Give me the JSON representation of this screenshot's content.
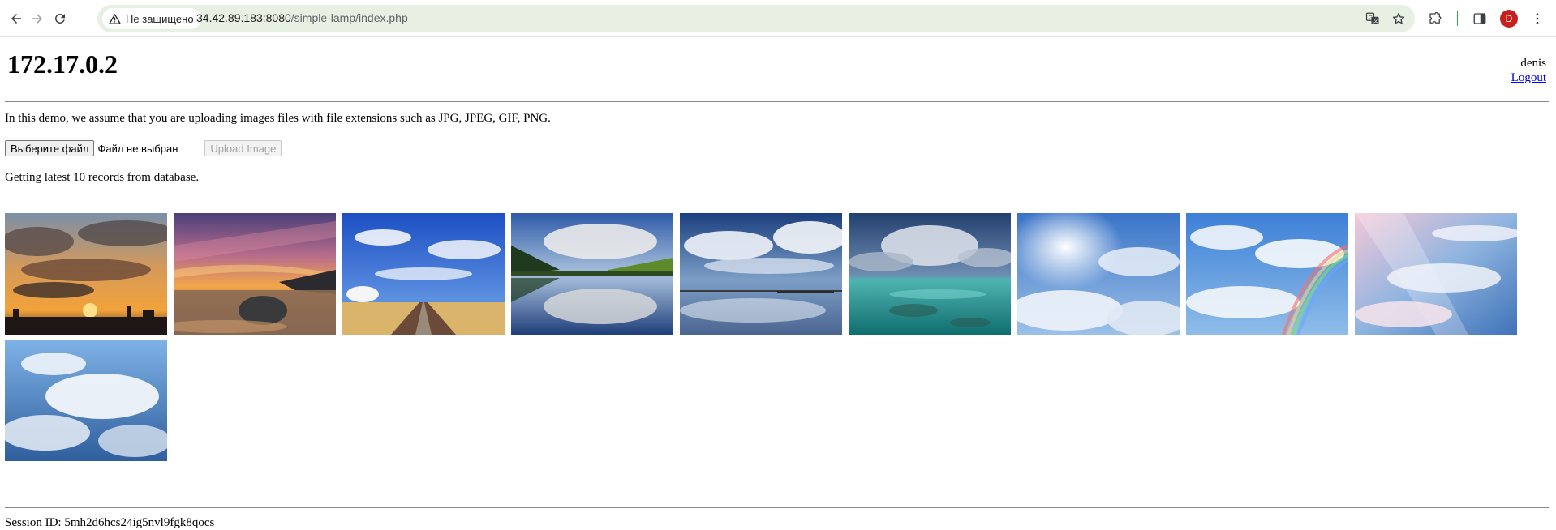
{
  "browser": {
    "security_label": "Не защищено",
    "url_host": "34.42.89.183:8080",
    "url_path": "/simple-lamp/index.php",
    "profile_initial": "D",
    "icons": [
      "back-icon",
      "forward-icon",
      "reload-icon",
      "warning-icon",
      "translate-icon",
      "star-icon",
      "extensions-icon",
      "side-panel-icon"
    ]
  },
  "header": {
    "host_ip": "172.17.0.2",
    "username": "denis",
    "logout_label": "Logout"
  },
  "upload": {
    "intro_text": "In this demo, we assume that you are uploading images files with file extensions such as JPG, JPEG, GIF, PNG.",
    "choose_file_label": "Выберите файл",
    "file_status": "Файл не выбран",
    "upload_button_label": "Upload Image"
  },
  "records_note": "Getting latest 10 records from database.",
  "gallery": {
    "images": [
      {
        "scene": "sunset-clouds-city"
      },
      {
        "scene": "sunset-beach-rock"
      },
      {
        "scene": "blue-sky-railroad-field"
      },
      {
        "scene": "lake-reflection-forest"
      },
      {
        "scene": "clouds-over-lake-pier"
      },
      {
        "scene": "turquoise-sea-clouds"
      },
      {
        "scene": "sun-rays-clouds"
      },
      {
        "scene": "rainbow-clouds"
      },
      {
        "scene": "pastel-clouds-light"
      },
      {
        "scene": "bright-cloudscape"
      }
    ]
  },
  "footer": {
    "session_text": "Session ID: 5mh2d6hcs24ig5nvl9fgk8qocs"
  },
  "colors": {
    "omnibox_bg": "#e8efe3",
    "link": "#0000ee",
    "profile": "#c5221f"
  }
}
